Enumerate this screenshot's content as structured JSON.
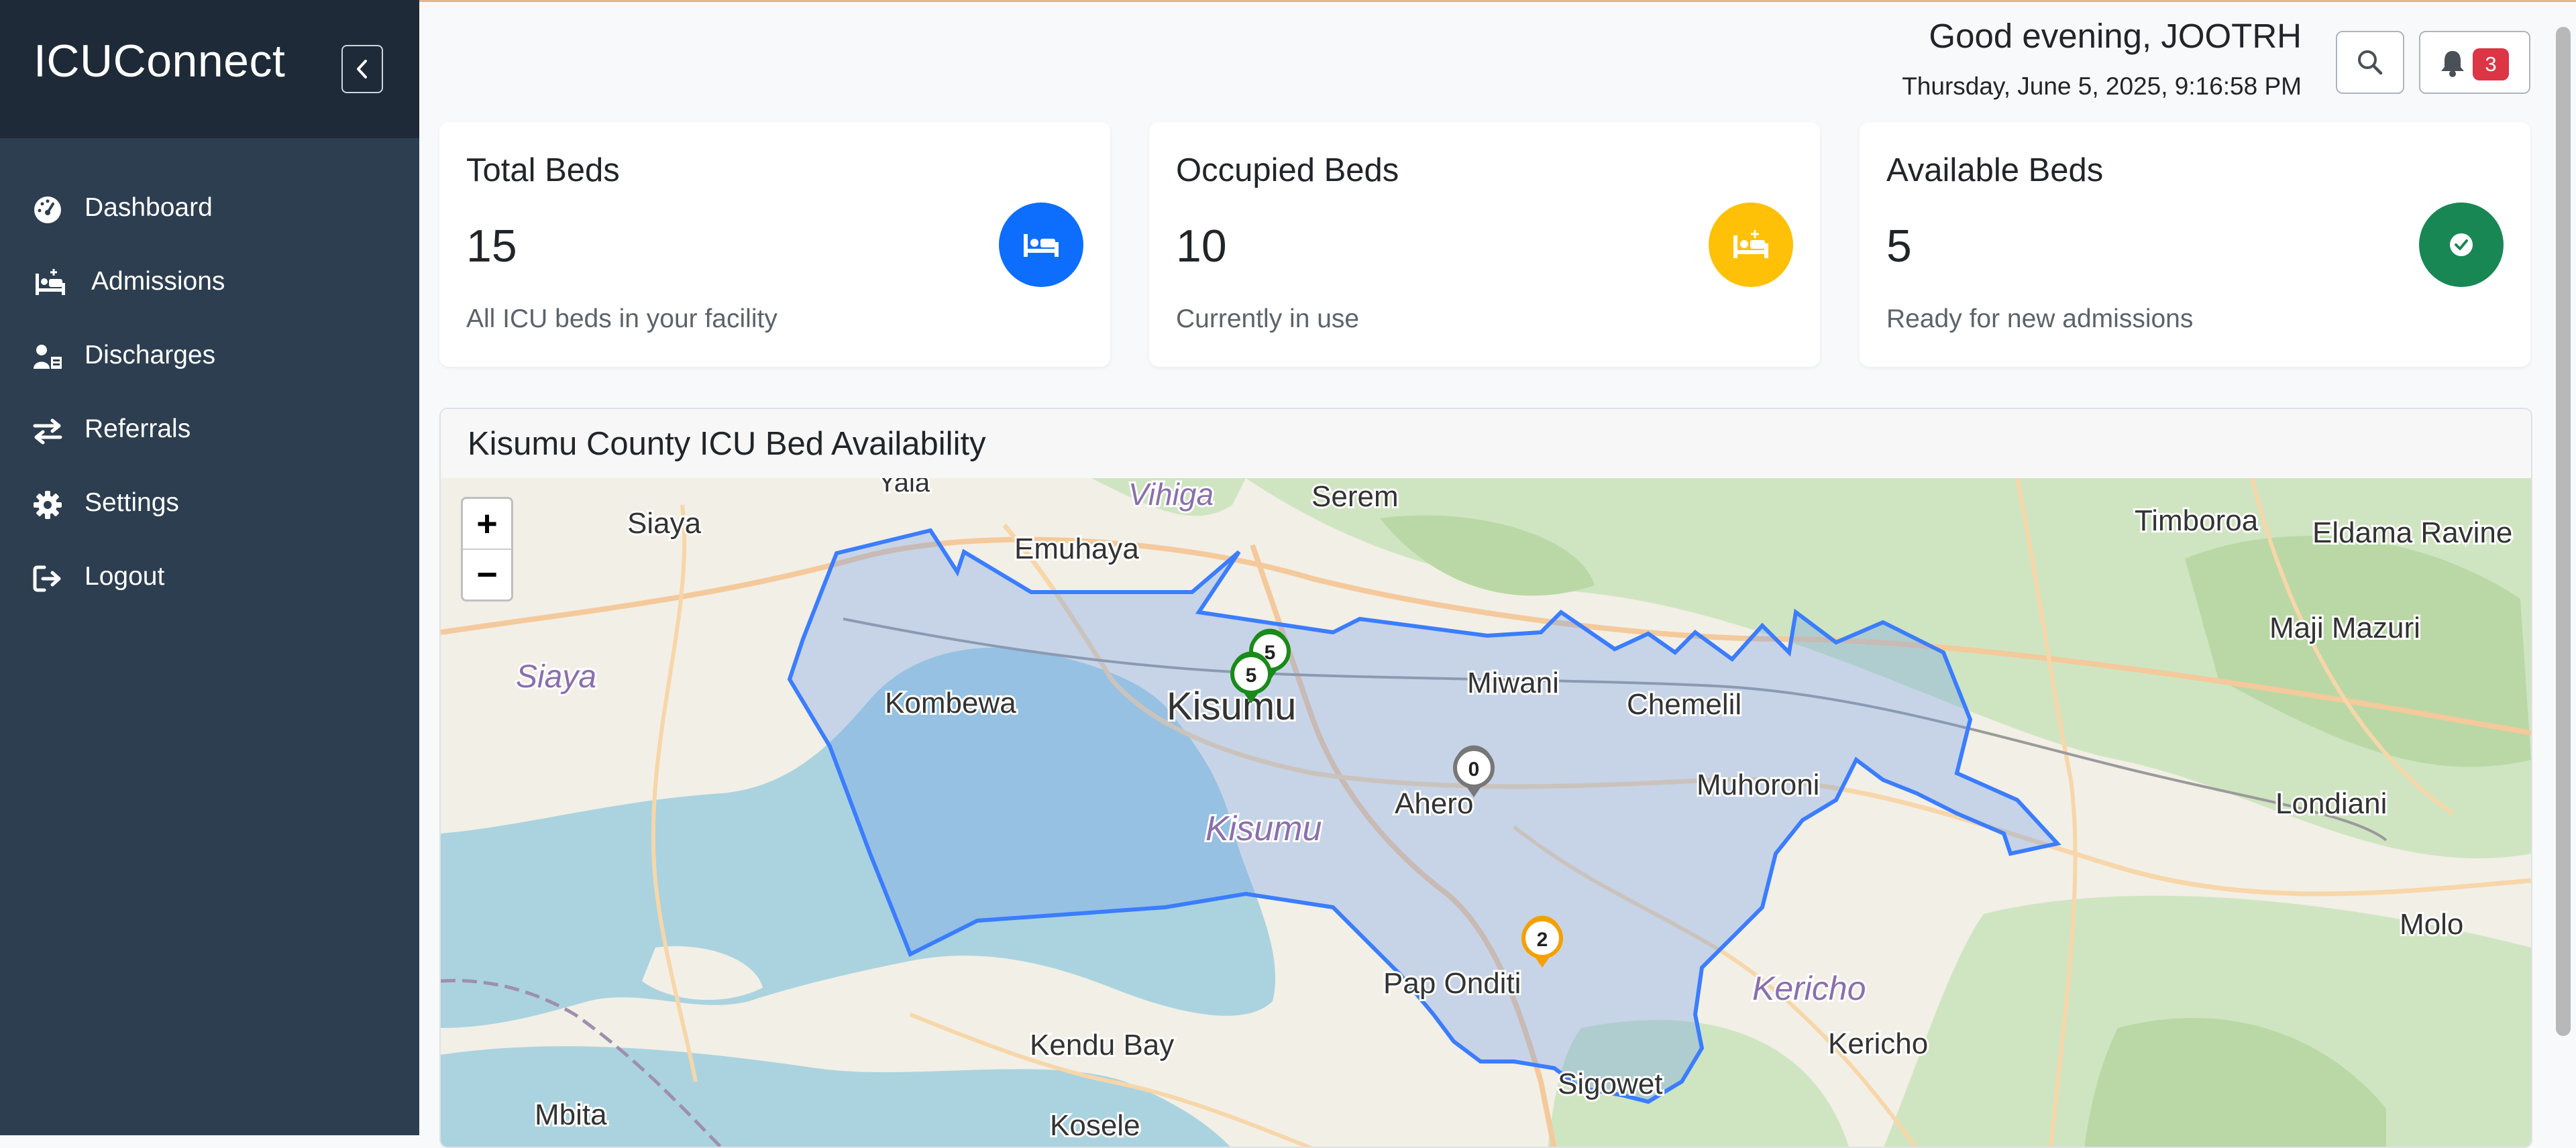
{
  "app": {
    "brand": "ICUConnect"
  },
  "sidebar": {
    "items": [
      {
        "label": "Dashboard",
        "icon": "dashboard-gauge-icon"
      },
      {
        "label": "Admissions",
        "icon": "bed-person-icon"
      },
      {
        "label": "Discharges",
        "icon": "user-discharge-icon"
      },
      {
        "label": "Referrals",
        "icon": "exchange-arrows-icon"
      },
      {
        "label": "Settings",
        "icon": "gear-icon"
      },
      {
        "label": "Logout",
        "icon": "logout-icon"
      }
    ]
  },
  "header": {
    "greeting": "Good evening, JOOTRH",
    "datetime": "Thursday, June 5, 2025, 9:16:58 PM",
    "notification_count": "3"
  },
  "cards": [
    {
      "title": "Total Beds",
      "value": "15",
      "subtitle": "All ICU beds in your facility",
      "color": "#0d6efd",
      "icon": "bed-icon"
    },
    {
      "title": "Occupied Beds",
      "value": "10",
      "subtitle": "Currently in use",
      "color": "#ffc107",
      "icon": "occupied-bed-icon"
    },
    {
      "title": "Available Beds",
      "value": "5",
      "subtitle": "Ready for new admissions",
      "color": "#198754",
      "icon": "check-circle-icon"
    }
  ],
  "map": {
    "title": "Kisumu County ICU Bed Availability",
    "zoom_in": "+",
    "zoom_out": "−",
    "places": {
      "yala": "Yala",
      "vihiga": "Vihiga",
      "serem": "Serem",
      "siaya_town": "Siaya",
      "emuhaya": "Emuhaya",
      "siaya_county": "Siaya",
      "kombewa": "Kombewa",
      "kisumu_city": "Kisumu",
      "miwani": "Miwani",
      "chemelil": "Chemelil",
      "muhoroni": "Muhoroni",
      "ahero": "Ahero",
      "kisumu_county": "Kisumu",
      "pap_onditi": "Pap Onditi",
      "kericho_county": "Kericho",
      "kericho_town": "Kericho",
      "kendu_bay": "Kendu Bay",
      "sigowet": "Sigowet",
      "mbita": "Mbita",
      "kosele": "Kosele",
      "timboroa": "Timboroa",
      "eldama_ravine": "Eldama Ravine",
      "maji_mazuri": "Maji Mazuri",
      "londiani": "Londiani",
      "molo": "Molo"
    },
    "markers": [
      {
        "label": "5",
        "color": "#1a8a1a"
      },
      {
        "label": "5",
        "color": "#1a8a1a"
      },
      {
        "label": "0",
        "color": "#777777"
      },
      {
        "label": "2",
        "color": "#f5a000"
      }
    ]
  }
}
